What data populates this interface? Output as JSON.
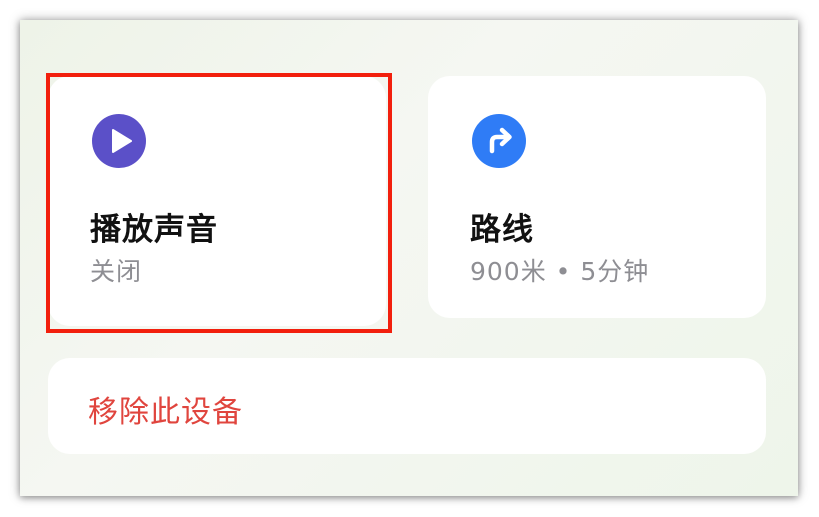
{
  "cards": {
    "sound": {
      "title": "播放声音",
      "status": "关闭",
      "icon": "play-icon",
      "icon_color": "#5b50c8"
    },
    "route": {
      "title": "路线",
      "detail": "900米 • 5分钟",
      "icon": "turn-right-arrow-icon",
      "icon_color": "#2f7cf6"
    }
  },
  "remove_device": {
    "label": "移除此设备",
    "color": "#e0453e"
  },
  "highlight_color": "#f21f0d"
}
